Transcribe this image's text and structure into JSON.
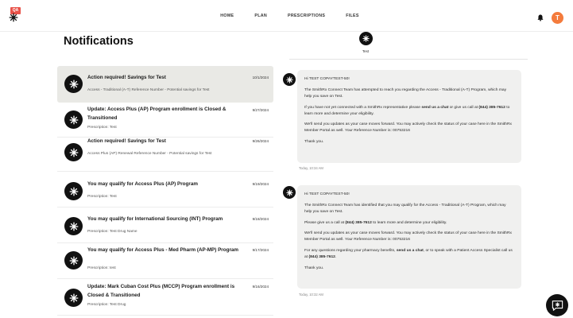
{
  "env_badge": "QA",
  "nav": {
    "home": "HOME",
    "plan": "PLAN",
    "prescriptions": "PRESCRIPTIONS",
    "files": "FILES"
  },
  "user": {
    "initial": "T"
  },
  "page_title": "Notifications",
  "notifications": [
    {
      "title": "Action required! Savings for Test",
      "subtitle": "Access - Traditional (A-T) Reference Number - Potential savings for Test",
      "date": "10/1/2024",
      "selected": true
    },
    {
      "title": "Update: Access Plus (AP) Program enrollment is Closed & Transitioned",
      "subtitle": "Prescription: Test",
      "date": "9/27/2024"
    },
    {
      "title": "Action required! Savings for Test",
      "subtitle": "Access Plus (AP) Renewal Reference Number - Potential savings for Test",
      "date": "9/26/2024"
    },
    {
      "title": "You may qualify for Access Plus (AP) Program",
      "subtitle": "Prescription: Test",
      "date": "9/19/2024"
    },
    {
      "title": "You may qualify for International Sourcing (INT) Program",
      "subtitle": "Prescription: Test Drug Name",
      "date": "9/18/2024"
    },
    {
      "title": "You may qualify for Access Plus - Med Pharm (AP-MP) Program",
      "subtitle": "Prescription: test",
      "date": "9/17/2024"
    },
    {
      "title": "Update: Mark Cuban Cost Plus (MCCP) Program enrollment is Closed & Transitioned",
      "subtitle": "Prescription: Test Drug",
      "date": "9/16/2024"
    }
  ],
  "chat": {
    "name": "Test",
    "messages": [
      {
        "greeting": "Hi TEST COPAYTEST-50!",
        "p1": "The SmithRx Connect Team has attempted to reach you regarding the Access - Traditional (A-T) Program, which may help you save on Test.",
        "p2_a": "If you have not yet connected with a SmithRx representative please ",
        "p2_b": "send us a chat",
        "p2_c": " or give us call at ",
        "p2_d": "(844) 385-7612",
        "p2_e": " to learn more and determine your eligibility.",
        "p3": "We'll send you updates as your case moves forward. You may actively check the status of your case here in the SmithRx Member Portal as well. Your Reference Number is: 00753216",
        "thanks": "Thank you.",
        "time": "Today, 10:34 AM"
      },
      {
        "greeting": "Hi TEST COPAYTEST-50!",
        "p1": "The SmithRx Connect Team has identified that you may qualify for the Access - Traditional (A-T) Program, which may help you save on Test.",
        "p2_a": "Please give us a call at ",
        "p2_b": "(844) 385-7612",
        "p2_c": " to learn more and determine your eligibility.",
        "p3": "We'll send you updates as your case moves forward. You may actively check the status of your case here in the SmithRx Member Portal as well. Your Reference Number is: 00753216",
        "p4_a": "For any questions regarding your pharmacy benefits, ",
        "p4_b": "send us a chat",
        "p4_c": ", or to speak with a Patient Access Specialist call us at ",
        "p4_d": "(844) 385-7612",
        "p4_e": ".",
        "thanks": "Thank you.",
        "time": "Today, 10:32 AM"
      }
    ]
  }
}
